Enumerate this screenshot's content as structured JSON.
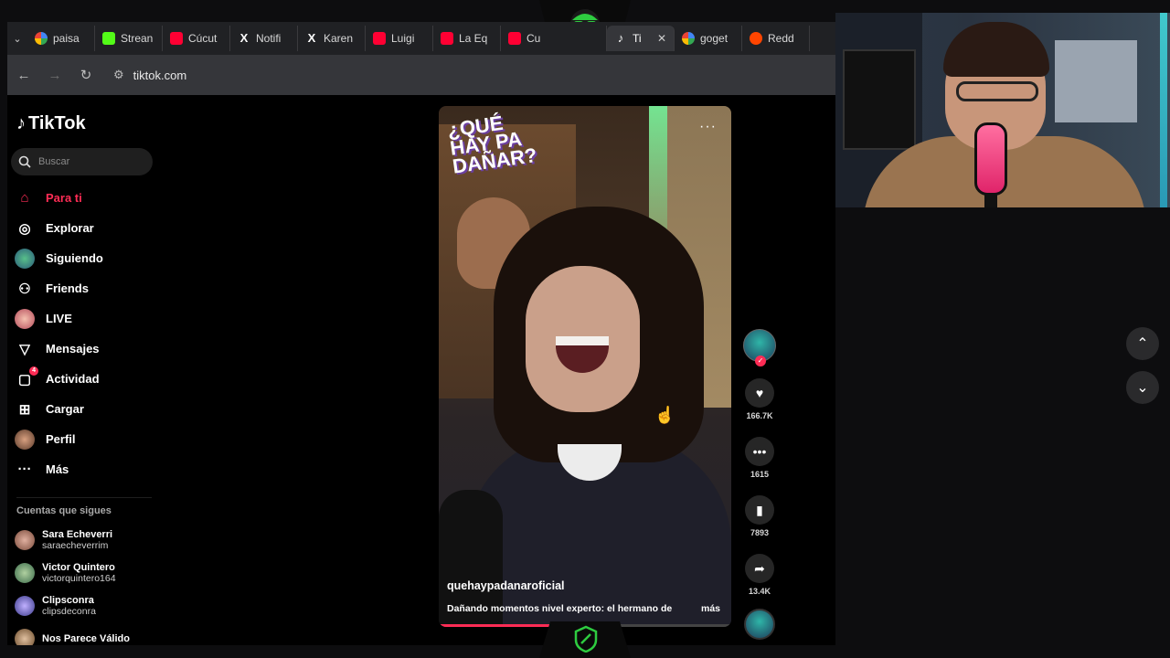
{
  "browser": {
    "tabs": [
      {
        "label": "paisa",
        "icon": "google-icon",
        "color": "#ffffff"
      },
      {
        "label": "Strean",
        "icon": "kick-icon",
        "color": "#53fc18"
      },
      {
        "label": "Cúcut",
        "icon": "youtube-icon",
        "color": "#ff0033"
      },
      {
        "label": "Notifi",
        "icon": "x-icon",
        "color": "#ffffff"
      },
      {
        "label": "Karen",
        "icon": "x-icon",
        "color": "#ffffff"
      },
      {
        "label": "Luigi",
        "icon": "youtube-icon",
        "color": "#ff0033"
      },
      {
        "label": "La Eq",
        "icon": "youtube-icon",
        "color": "#ff0033"
      },
      {
        "label": "Cu",
        "icon": "youtube-icon",
        "color": "#ff0033"
      },
      {
        "label": "Ti",
        "icon": "tiktok-icon",
        "color": "#ffffff",
        "active": true
      },
      {
        "label": "goget",
        "icon": "google-icon",
        "color": "#ffffff"
      },
      {
        "label": "Redd",
        "icon": "reddit-icon",
        "color": "#ff4500"
      }
    ],
    "url": "tiktok.com"
  },
  "tiktok": {
    "logo": "TikTok",
    "search_placeholder": "Buscar",
    "nav": [
      {
        "label": "Para ti",
        "icon": "home-icon"
      },
      {
        "label": "Explorar",
        "icon": "compass-icon"
      },
      {
        "label": "Siguiendo",
        "icon": "following-avatar-icon"
      },
      {
        "label": "Friends",
        "icon": "friends-icon"
      },
      {
        "label": "LIVE",
        "icon": "live-icon"
      },
      {
        "label": "Mensajes",
        "icon": "send-icon"
      },
      {
        "label": "Actividad",
        "icon": "activity-icon",
        "badge": "4"
      },
      {
        "label": "Cargar",
        "icon": "upload-icon"
      },
      {
        "label": "Perfil",
        "icon": "profile-avatar-icon"
      },
      {
        "label": "Más",
        "icon": "more-icon"
      }
    ],
    "following_title": "Cuentas que sigues",
    "following": [
      {
        "name": "Sara Echeverri",
        "handle": "saraecheverrim",
        "color": "#7a4a3a"
      },
      {
        "name": "Victor Quintero",
        "handle": "victorquintero164",
        "color": "#6a8a6a"
      },
      {
        "name": "Clipsconra",
        "handle": "clipsdeconra",
        "color": "#5a5aa0"
      },
      {
        "name": "Nos Parece Válido",
        "handle": "",
        "color": "#8a6a4a"
      }
    ],
    "video": {
      "show_logo": "¿QUÉ HAY PA DAÑAR?",
      "username": "quehaypadanaroficial",
      "description": "Dañando momentos nivel experto: el hermano de",
      "more_label": "más",
      "progress": 0.38
    },
    "actions": {
      "likes": "166.7K",
      "comments": "1615",
      "saves": "7893",
      "shares": "13.4K"
    }
  }
}
